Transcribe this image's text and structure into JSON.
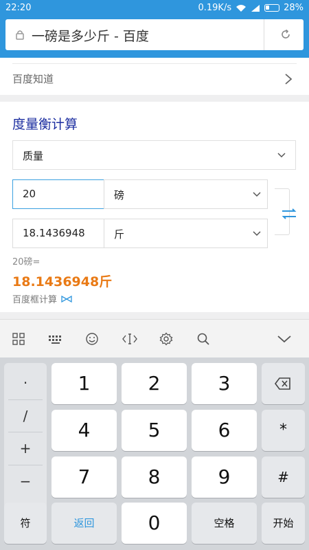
{
  "status": {
    "time": "22:20",
    "speed": "0.19K/s",
    "battery": "28%"
  },
  "browser": {
    "title": "一磅是多少斤 - 百度"
  },
  "source": {
    "label": "百度知道"
  },
  "calculator": {
    "heading": "度量衡计算",
    "category": "质量",
    "from_value": "20",
    "from_unit": "磅",
    "to_value": "18.1436948",
    "to_unit": "斤",
    "formula": "20磅=",
    "result": "18.1436948斤",
    "footer": "百度框计算"
  },
  "toolbar_icons": [
    "grid-icon",
    "keyboard-icon",
    "emoji-icon",
    "cursor-icon",
    "settings-icon",
    "search-icon",
    "collapse-icon"
  ],
  "keyboard": {
    "symbols": [
      ".",
      "/",
      "+",
      "−"
    ],
    "digits": [
      "1",
      "2",
      "3",
      "4",
      "5",
      "6",
      "7",
      "8",
      "9",
      "0"
    ],
    "star": "*",
    "hash": "#",
    "symbol_key": "符",
    "back_key": "返回",
    "space_key": "空格",
    "start_key": "开始"
  },
  "colors": {
    "accent": "#2f96dd",
    "heading": "#1c2ea0",
    "result": "#e97a15"
  }
}
